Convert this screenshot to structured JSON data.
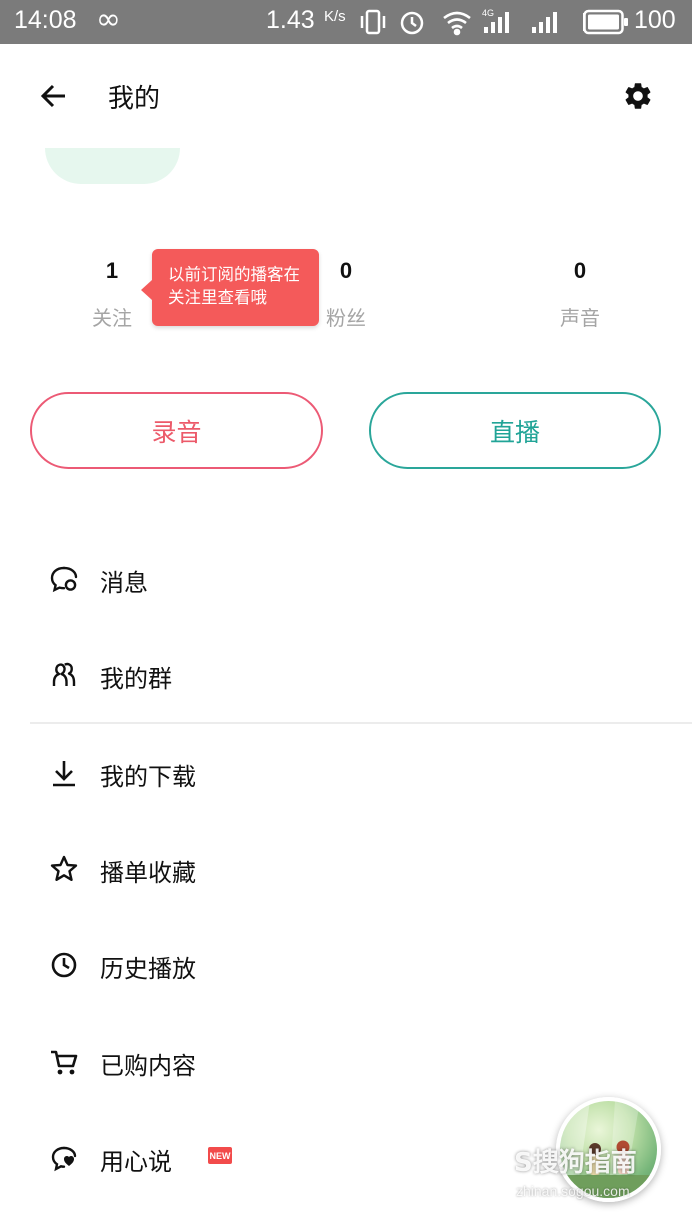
{
  "status_bar": {
    "time": "14:08",
    "infinity_symbol": "∞",
    "speed": "1.43",
    "speed_unit": "K/s",
    "battery": "100"
  },
  "header": {
    "title": "我的",
    "back_icon": "arrow-left-icon",
    "settings_icon": "gear-icon"
  },
  "stats": [
    {
      "value": "1",
      "label": "关注"
    },
    {
      "value": "0",
      "label": "粉丝"
    },
    {
      "value": "0",
      "label": "声音"
    }
  ],
  "tooltip": {
    "line1": "以前订阅的播客在",
    "line2": "关注里查看哦"
  },
  "buttons": {
    "record": "录音",
    "live": "直播"
  },
  "menu": [
    {
      "label": "消息",
      "icon": "chat-bubble-icon"
    },
    {
      "label": "我的群",
      "icon": "group-icon"
    },
    {
      "label": "我的下载",
      "icon": "download-icon"
    },
    {
      "label": "播单收藏",
      "icon": "star-icon"
    },
    {
      "label": "历史播放",
      "icon": "clock-icon"
    },
    {
      "label": "已购内容",
      "icon": "cart-icon"
    },
    {
      "label": "用心说",
      "icon": "heart-chat-icon",
      "badge": "NEW"
    }
  ],
  "watermark": {
    "text": "S搜狗指南",
    "sub": "zhinan.sogou.com"
  },
  "colors": {
    "record": "#ec5a6a",
    "live": "#21a497",
    "tooltip": "#f45a5a",
    "status_bar": "#7b7b7b"
  }
}
